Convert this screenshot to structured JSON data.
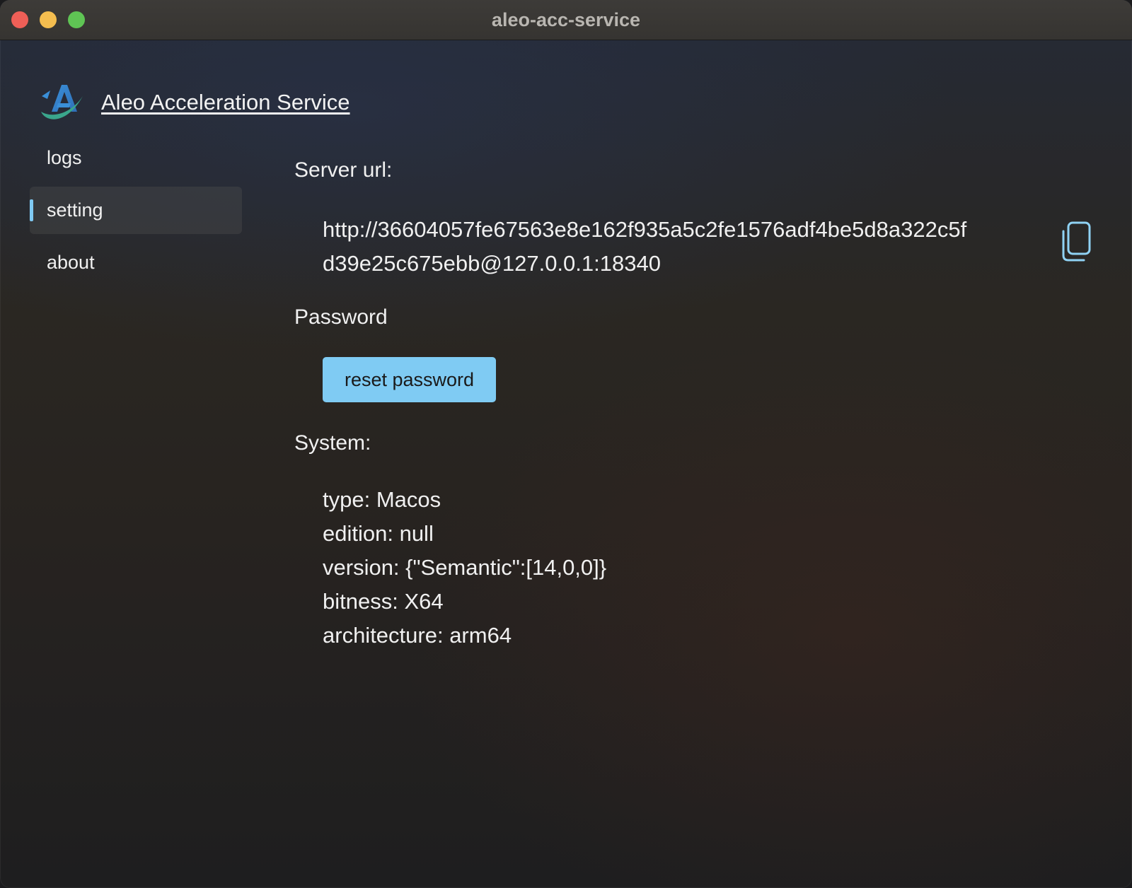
{
  "window": {
    "title": "aleo-acc-service"
  },
  "app": {
    "title": "Aleo Acceleration Service"
  },
  "sidebar": {
    "items": [
      {
        "label": "logs",
        "active": false
      },
      {
        "label": "setting",
        "active": true
      },
      {
        "label": "about",
        "active": false
      }
    ]
  },
  "settings": {
    "server_url_label": "Server url:",
    "server_url": "http://36604057fe67563e8e162f935a5c2fe1576adf4be5d8a322c5fd39e25c675ebb@127.0.0.1:18340",
    "password_label": "Password",
    "reset_password_label": "reset password",
    "system_label": "System:",
    "system": [
      "type: Macos",
      "edition: null",
      "version: {\"Semantic\":[14,0,0]}",
      "bitness: X64",
      "architecture: arm64"
    ]
  },
  "icons": {
    "copy": "copy-icon",
    "logo": "app-logo"
  },
  "colors": {
    "accent": "#7fcbf3",
    "close": "#ee5f57",
    "minimize": "#f4bd4f",
    "maximize": "#5fc454"
  }
}
